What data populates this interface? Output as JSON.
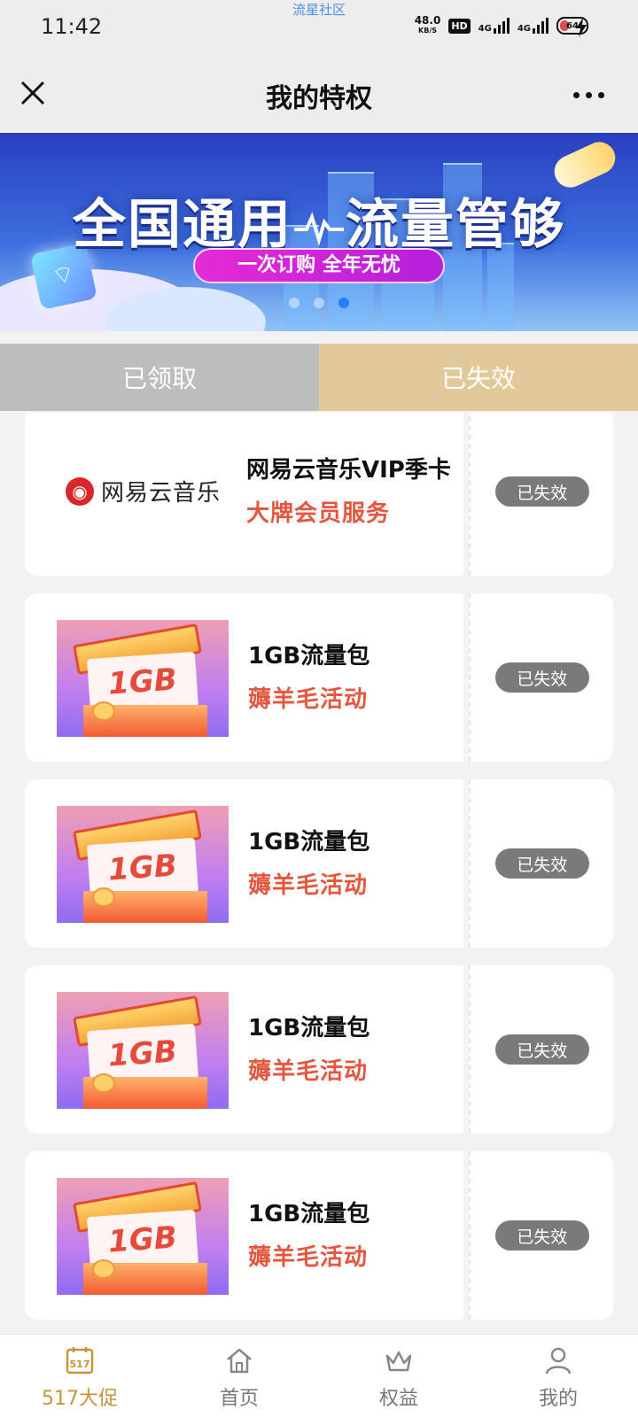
{
  "status_bar": {
    "time": "11:42",
    "watermark": "流星社区",
    "speed": "48.0",
    "speed_unit": "KB/S",
    "hd": "HD",
    "sim1": "4G",
    "sim2": "4G",
    "battery": "64"
  },
  "nav": {
    "title": "我的特权"
  },
  "banner": {
    "title_left": "全国通用",
    "title_right": "流量管够",
    "subtitle": "一次订购 全年无忧",
    "pages": 3,
    "active_page": 3
  },
  "tabs": [
    {
      "label": "已领取",
      "active": false
    },
    {
      "label": "已失效",
      "active": true
    }
  ],
  "cards": [
    {
      "type": "brand",
      "brand_text": "网易云音乐",
      "brand_mark": "◉",
      "title": "网易云音乐VIP季卡",
      "subtitle": "大牌会员服务",
      "status": "已失效"
    },
    {
      "type": "data",
      "thumb_text": "1GB",
      "title": "1GB流量包",
      "subtitle": "薅羊毛活动",
      "status": "已失效"
    },
    {
      "type": "data",
      "thumb_text": "1GB",
      "title": "1GB流量包",
      "subtitle": "薅羊毛活动",
      "status": "已失效"
    },
    {
      "type": "data",
      "thumb_text": "1GB",
      "title": "1GB流量包",
      "subtitle": "薅羊毛活动",
      "status": "已失效"
    },
    {
      "type": "data",
      "thumb_text": "1GB",
      "title": "1GB流量包",
      "subtitle": "薅羊毛活动",
      "status": "已失效"
    }
  ],
  "tabbar": [
    {
      "label": "517大促",
      "icon": "calendar-517-icon",
      "icon_text": "517",
      "active": true
    },
    {
      "label": "首页",
      "icon": "home-icon",
      "active": false
    },
    {
      "label": "权益",
      "icon": "crown-icon",
      "active": false
    },
    {
      "label": "我的",
      "icon": "user-icon",
      "active": false
    }
  ],
  "colors": {
    "accent_gold": "#c7943a",
    "tab_expired_bg": "#e2c99a",
    "tab_received_bg": "#bdbdbd",
    "subtitle_red": "#e4573e",
    "status_pill": "#7a7a7a"
  }
}
